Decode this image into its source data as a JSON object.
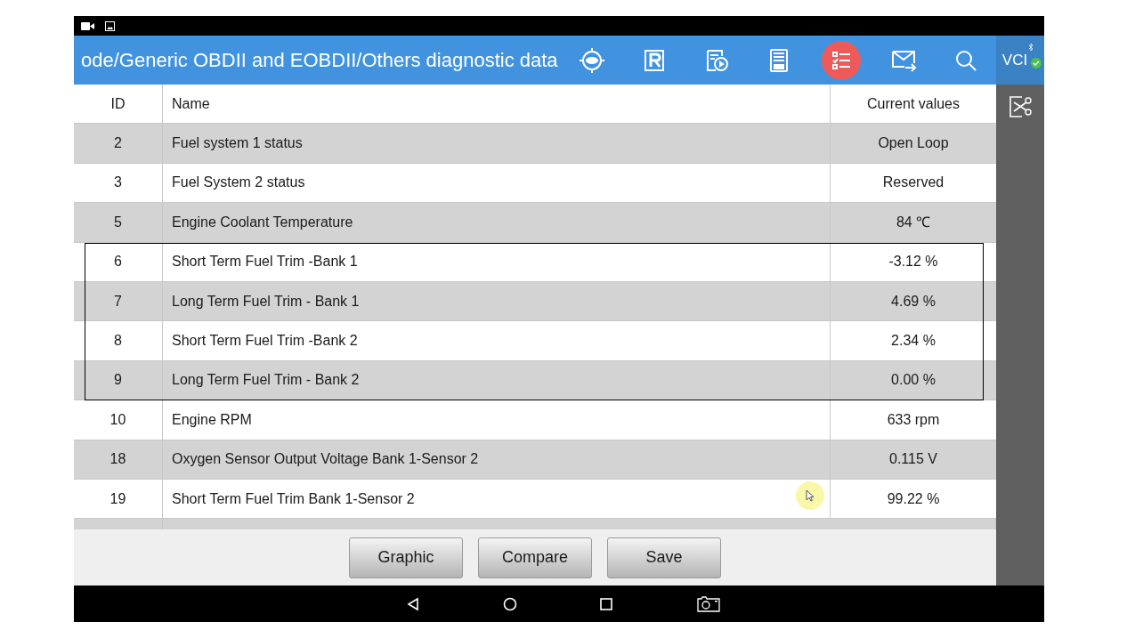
{
  "header": {
    "title": "ode/Generic OBDII and EOBDII/Others diagnostic data",
    "vci_label": "VCI",
    "vci_connected": true
  },
  "toolbar": [
    {
      "kind": "obd",
      "selected": false
    },
    {
      "kind": "report",
      "selected": false
    },
    {
      "kind": "replay",
      "selected": false
    },
    {
      "kind": "save",
      "selected": false
    },
    {
      "kind": "list",
      "selected": true
    },
    {
      "kind": "mail",
      "selected": false
    },
    {
      "kind": "search",
      "selected": false
    }
  ],
  "table": {
    "columns": [
      "ID",
      "Name",
      "Current values"
    ],
    "rows": [
      {
        "id": "2",
        "name": "Fuel system 1 status",
        "value": "Open Loop",
        "framed": false
      },
      {
        "id": "3",
        "name": "Fuel System 2 status",
        "value": "Reserved",
        "framed": false
      },
      {
        "id": "5",
        "name": "Engine Coolant Temperature",
        "value": "84 ℃",
        "framed": false
      },
      {
        "id": "6",
        "name": "Short Term Fuel Trim -Bank 1",
        "value": "-3.12 %",
        "framed": true
      },
      {
        "id": "7",
        "name": "Long Term Fuel Trim - Bank 1",
        "value": "4.69 %",
        "framed": true
      },
      {
        "id": "8",
        "name": "Short Term Fuel Trim -Bank 2",
        "value": "2.34 %",
        "framed": true
      },
      {
        "id": "9",
        "name": "Long Term Fuel Trim - Bank 2",
        "value": "0.00 %",
        "framed": true
      },
      {
        "id": "10",
        "name": "Engine RPM",
        "value": "633 rpm",
        "framed": false
      },
      {
        "id": "18",
        "name": "Oxygen Sensor Output Voltage Bank 1-Sensor 2",
        "value": "0.115 V",
        "framed": false
      },
      {
        "id": "19",
        "name": "Short Term Fuel Trim Bank 1-Sensor 2",
        "value": "99.22 %",
        "framed": false
      }
    ]
  },
  "buttons": [
    "Graphic",
    "Compare",
    "Save"
  ]
}
